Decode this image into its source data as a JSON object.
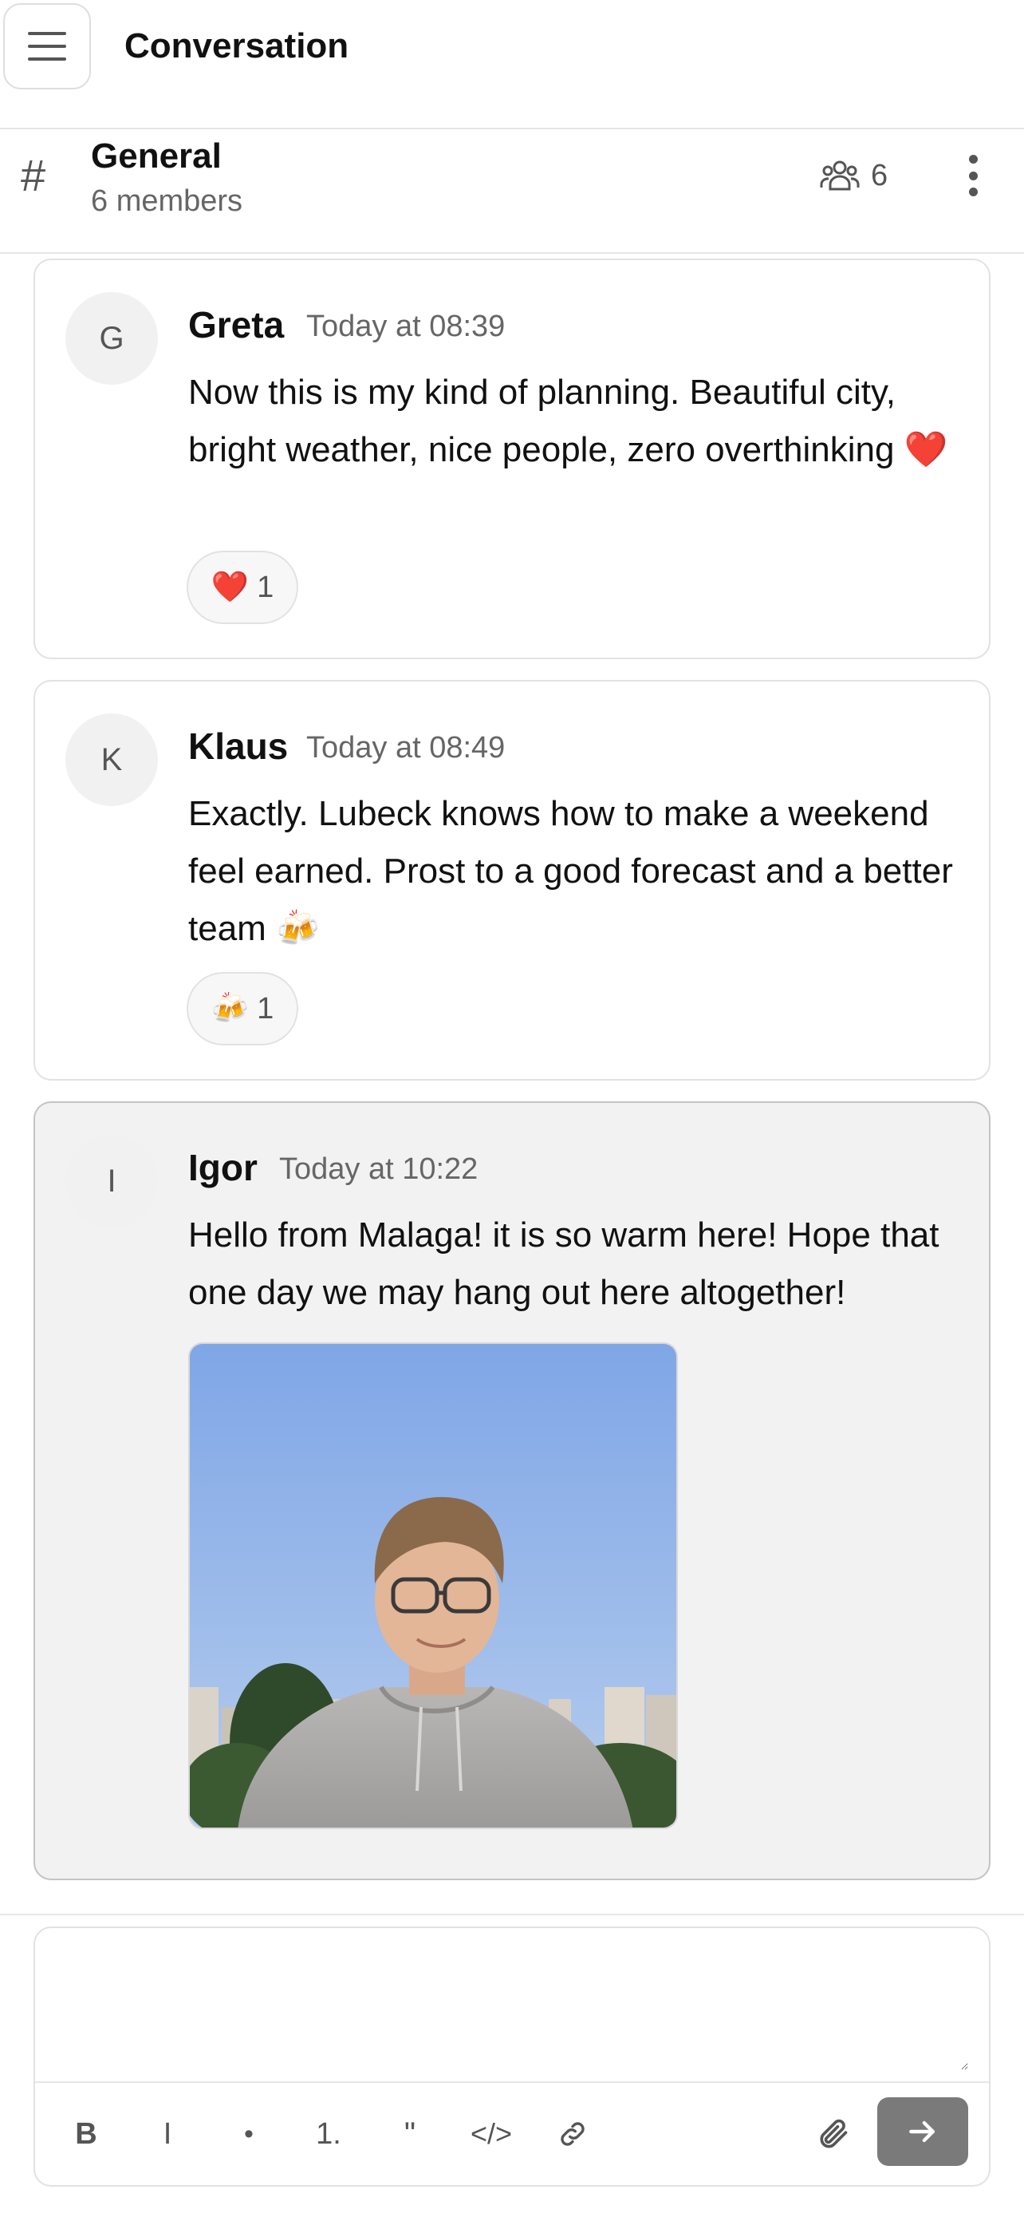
{
  "app": {
    "title": "Conversation"
  },
  "channel": {
    "hash": "#",
    "name": "General",
    "subtitle": "6 members",
    "member_count": "6"
  },
  "messages": [
    {
      "initial": "G",
      "author": "Greta",
      "time": "Today at 08:39",
      "text": "Now this is my kind of planning. Beautiful city, bright weather, nice people, zero overthinking ❤️",
      "reaction": {
        "emoji": "❤️",
        "count": "1"
      }
    },
    {
      "initial": "K",
      "author": "Klaus",
      "time": "Today at 08:49",
      "text": "Exactly. Lubeck knows how to make a weekend feel earned. Prost to a good forecast and a better team 🍻",
      "reaction": {
        "emoji": "🍻",
        "count": "1"
      }
    },
    {
      "initial": "I",
      "author": "Igor",
      "time": "Today at 10:22",
      "text": "Hello from Malaga! it is so warm here! Hope that one day we may hang out here altogether!",
      "image_alt": "photo"
    }
  ],
  "composer": {
    "placeholder": "",
    "tools": {
      "bold": "B",
      "italic": "I",
      "bullet": "•",
      "ordered": "1.",
      "quote": "\"",
      "code": "</>"
    }
  },
  "icons": {
    "menu": "hamburger-icon",
    "members": "people-icon",
    "more": "kebab-icon",
    "link": "link-icon",
    "attach": "paperclip-icon",
    "send": "arrow-right-icon"
  }
}
